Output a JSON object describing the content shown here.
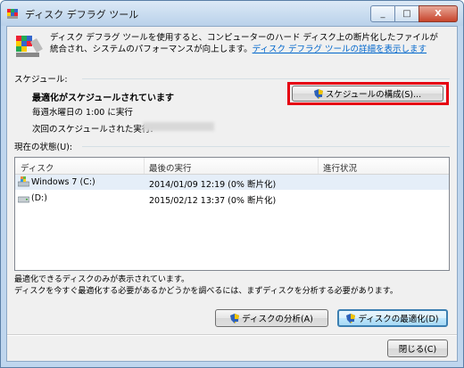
{
  "window": {
    "title": "ディスク デフラグ ツール",
    "minimize_glyph": "_",
    "maximize_glyph": "□",
    "close_glyph": "X"
  },
  "intro": {
    "text": "ディスク デフラグ ツールを使用すると、コンピューターのハード ディスク上の断片化したファイルが統合され、システムのパフォーマンスが向上します。",
    "link": "ディスク デフラグ ツールの詳細を表示します"
  },
  "schedule": {
    "section_label": "スケジュール:",
    "status": "最適化がスケジュールされています",
    "when": "毎週水曜日の 1:00 に実行",
    "next_label": "次回のスケジュールされた実行:",
    "configure_button": "スケジュールの構成(S)..."
  },
  "current": {
    "section_label": "現在の状態(U):",
    "columns": [
      "ディスク",
      "最後の実行",
      "進行状況"
    ],
    "rows": [
      {
        "disk": "Windows 7 (C:)",
        "last_run": "2014/01/09 12:19 (0% 断片化)",
        "progress": "",
        "icon": "windows-drive-icon"
      },
      {
        "disk": "(D:)",
        "last_run": "2015/02/12 13:37 (0% 断片化)",
        "progress": "",
        "icon": "hard-drive-icon"
      }
    ]
  },
  "notes": {
    "line1": "最適化できるディスクのみが表示されています。",
    "line2": "ディスクを今すぐ最適化する必要があるかどうかを調べるには、まずディスクを分析する必要があります。"
  },
  "buttons": {
    "analyze": "ディスクの分析(A)",
    "defrag": "ディスクの最適化(D)",
    "close": "閉じる(C)"
  },
  "colors": {
    "highlight": "#e60012",
    "link": "#0066cc",
    "selection": "#e5eef8"
  }
}
